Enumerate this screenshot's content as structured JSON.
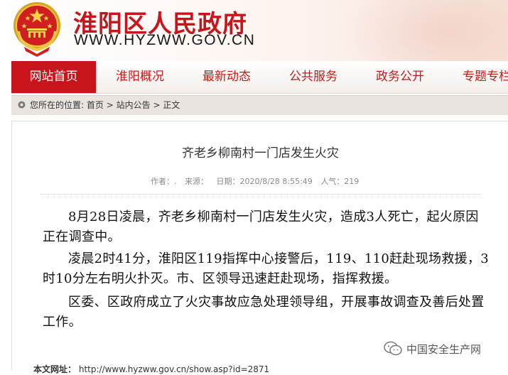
{
  "header": {
    "site_title": "淮阳区人民政府",
    "site_url": "WWW.HYZWW.GOV.CN",
    "brand_red": "#c8151b"
  },
  "nav": {
    "items": [
      {
        "label": "网站首页",
        "active": true
      },
      {
        "label": "淮阳概况",
        "active": false
      },
      {
        "label": "最新动态",
        "active": false
      },
      {
        "label": "公共服务",
        "active": false
      },
      {
        "label": "政务公开",
        "active": false
      },
      {
        "label": "专题专栏",
        "active": false
      }
    ]
  },
  "breadcrumb": {
    "prefix": "您所在的位置:",
    "items": [
      "首页",
      "站内公告",
      "正文"
    ],
    "separator": ">"
  },
  "article": {
    "title": "齐老乡柳南村一门店发生火灾",
    "meta": {
      "author": "作者：.",
      "source": "来源：",
      "date": "日期：2020/8/28 8:55:49",
      "popularity": "人气：219"
    },
    "paragraphs": [
      "8月28日凌晨，齐老乡柳南村一门店发生火灾，造成3人死亡，起火原因正在调查中。",
      "凌晨2时41分，淮阳区119指挥中心接警后，119、110赶赴现场救援，3时10分左右明火扑灭。市、区领导迅速赶赴现场，指挥救援。",
      "区委、区政府成立了火灾事故应急处理领导组，开展事故调查及善后处置工作。"
    ],
    "source_line_label": "本文网址：",
    "source_line_url": "http://www.hyzww.gov.cn/show.asp?id=2871"
  },
  "watermark": {
    "text": "中国安全生产网",
    "icon": "wechat-icon"
  }
}
